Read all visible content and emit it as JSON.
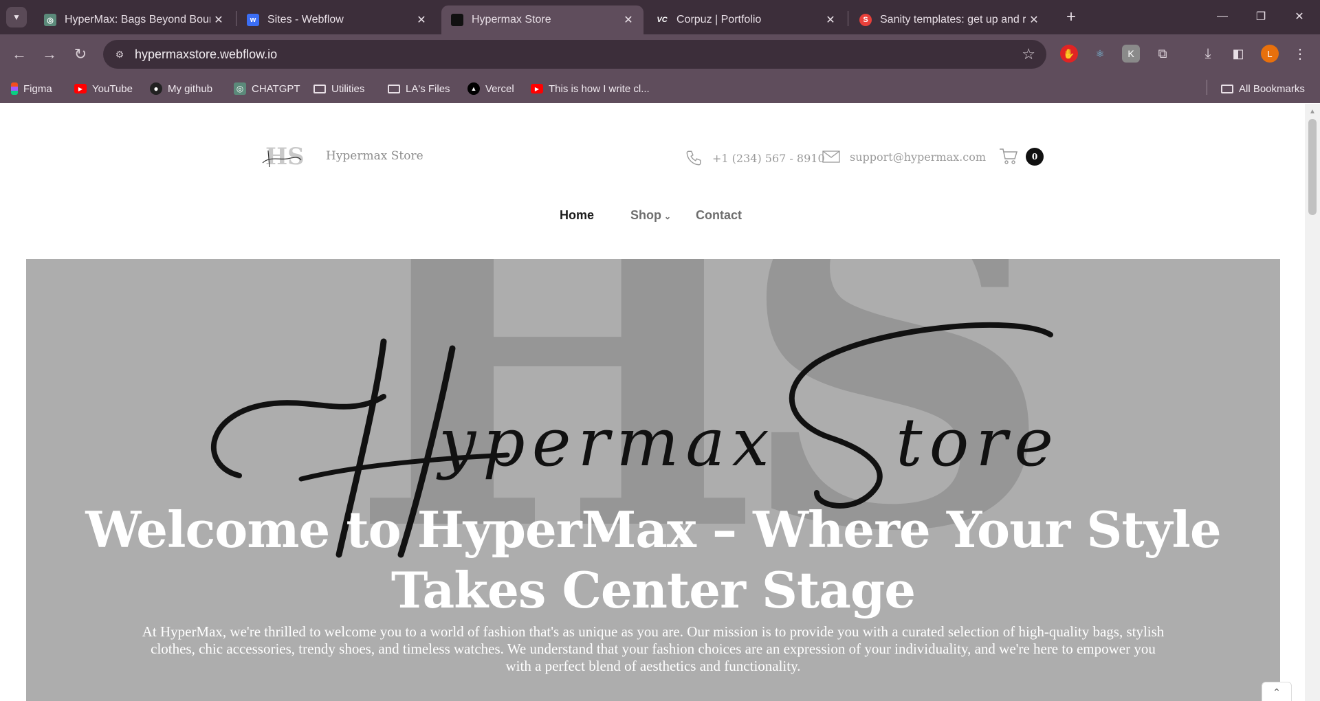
{
  "browser": {
    "tabs": [
      {
        "title": "HyperMax: Bags Beyond Bound",
        "active": false
      },
      {
        "title": "Sites - Webflow",
        "active": false
      },
      {
        "title": "Hypermax Store",
        "active": true
      },
      {
        "title": "Corpuz | Portfolio",
        "active": false
      },
      {
        "title": "Sanity templates: get up and ru",
        "active": false
      }
    ],
    "url": "hypermaxstore.webflow.io",
    "profile_initial": "L",
    "bookmarks": [
      "Figma",
      "YouTube",
      "My github",
      "CHATGPT",
      "Utilities",
      "LA's Files",
      "Vercel",
      "This is how I write cl..."
    ],
    "all_bookmarks": "All Bookmarks"
  },
  "site": {
    "brand": "Hypermax Store",
    "logo_letters": "HS",
    "phone": "+1 (234) 567 - 8910",
    "email": "support@hypermax.com",
    "cart_count": "0",
    "nav": [
      "Home",
      "Shop",
      "Contact"
    ],
    "hero": {
      "watermark": "HS",
      "script_logo": "Hypermax Store",
      "title": "Welcome to HyperMax – Where Your Style Takes Center Stage",
      "text": "At HyperMax, we're thrilled to welcome you to a world of fashion that's as unique as you are. Our mission is to provide you with a curated selection of high-quality bags, stylish clothes, chic accessories, trendy shoes, and timeless watches. We understand that your fashion choices are an expression of your individuality, and we're here to empower you with a perfect blend of aesthetics and functionality."
    }
  },
  "colors": {
    "chrome_dark": "#3c2e3a",
    "chrome_mid": "#5f4d5c",
    "hero_bg": "#adadad"
  }
}
